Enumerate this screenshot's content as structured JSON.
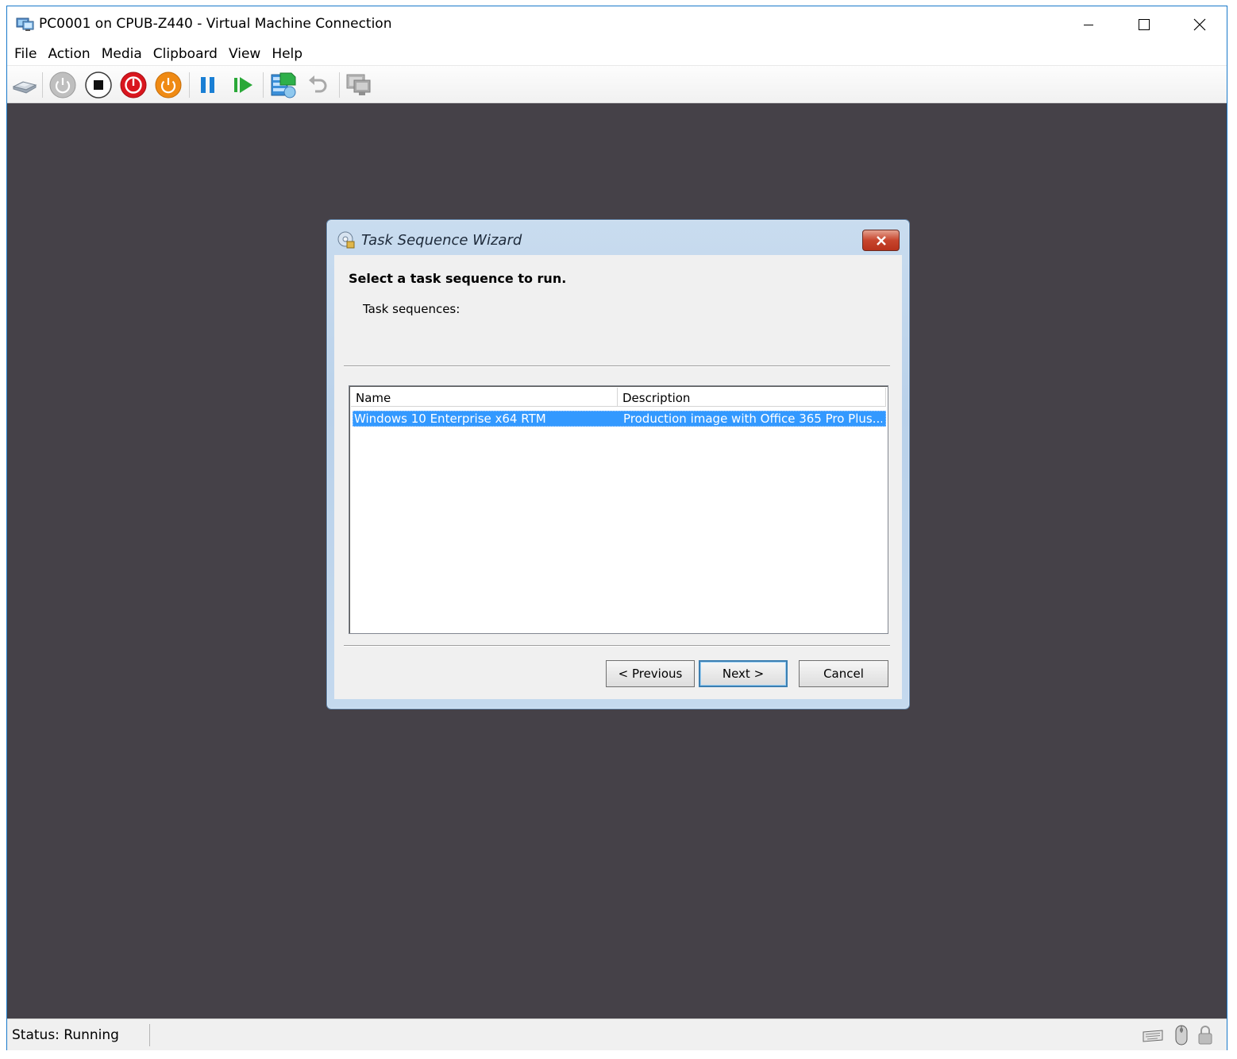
{
  "window": {
    "title": "PC0001 on CPUB-Z440 - Virtual Machine Connection"
  },
  "menu": {
    "items": [
      "File",
      "Action",
      "Media",
      "Clipboard",
      "View",
      "Help"
    ]
  },
  "toolbar": {
    "buttons": [
      "ctrl-alt-del-icon",
      "start-icon",
      "turn-off-icon",
      "shut-down-icon",
      "save-icon",
      "pause-icon",
      "resume-icon",
      "checkpoint-icon",
      "revert-icon",
      "enhanced-session-icon"
    ]
  },
  "dialog": {
    "title": "Task Sequence Wizard",
    "heading": "Select a task sequence to run.",
    "label": "Task sequences:",
    "columns": [
      "Name",
      "Description"
    ],
    "rows": [
      {
        "name": "Windows 10 Enterprise x64 RTM",
        "description": "Production image with Office 365 Pro Plus...",
        "selected": true
      }
    ],
    "buttons": {
      "previous": "< Previous",
      "next": "Next >",
      "cancel": "Cancel"
    }
  },
  "status": {
    "text": "Status: Running"
  },
  "colors": {
    "vm_background": "#454148",
    "selection": "#3399ff",
    "window_border": "#1979ca"
  }
}
